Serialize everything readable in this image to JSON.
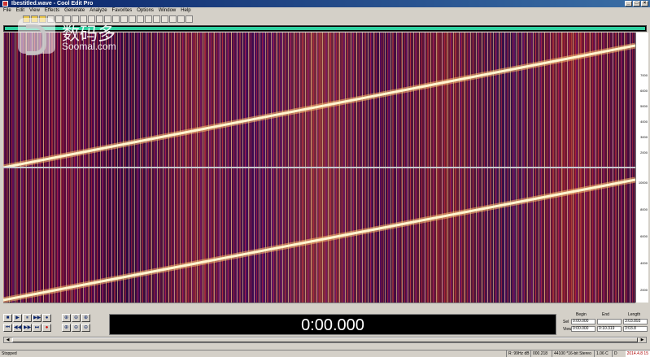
{
  "window": {
    "title": "Ibestitled.wave - Cool Edit Pro"
  },
  "window_controls": [
    "_",
    "□",
    "×"
  ],
  "menu": [
    "File",
    "Edit",
    "View",
    "Effects",
    "Generate",
    "Analyze",
    "Favorites",
    "Options",
    "Window",
    "Help"
  ],
  "watermark": {
    "cn": "数码多",
    "en": "Soomal.com"
  },
  "colors": {
    "overview_range": "#2fd0a0",
    "sweep": "#fff6d0",
    "spectral_bg": "#3a0a40"
  },
  "freq_ruler": {
    "ch1": [
      "7000",
      "6000",
      "5000",
      "4000",
      "3000",
      "2000"
    ],
    "ch2": [
      "10000",
      "8000",
      "6000",
      "4000",
      "2000"
    ]
  },
  "transport": {
    "buttons": [
      "■",
      "▶",
      "⏸",
      "▶▶",
      "●",
      "⏮",
      "◀◀",
      "▶▶",
      "⏭",
      "●"
    ]
  },
  "zoom": {
    "buttons": [
      "⊕",
      "⊖",
      "⊕",
      "⊕",
      "⊖",
      "⊖"
    ]
  },
  "time_display": "0:00.000",
  "selection": {
    "headers": [
      "Begin",
      "End",
      "Length"
    ],
    "rows": [
      {
        "label": "Sel",
        "begin": "0:00.000",
        "end": "",
        "length": "3:03.893"
      },
      {
        "label": "View",
        "begin": "0:00.000",
        "end": "0:10.319",
        "length": "3:03.8"
      }
    ]
  },
  "status": {
    "left": "Stopped",
    "cells": [
      "R: 99Hz dB",
      "000.218",
      "44100 *16-bit Stereo",
      "1.06 C",
      "D"
    ],
    "corner": "2014.4.8 15"
  }
}
